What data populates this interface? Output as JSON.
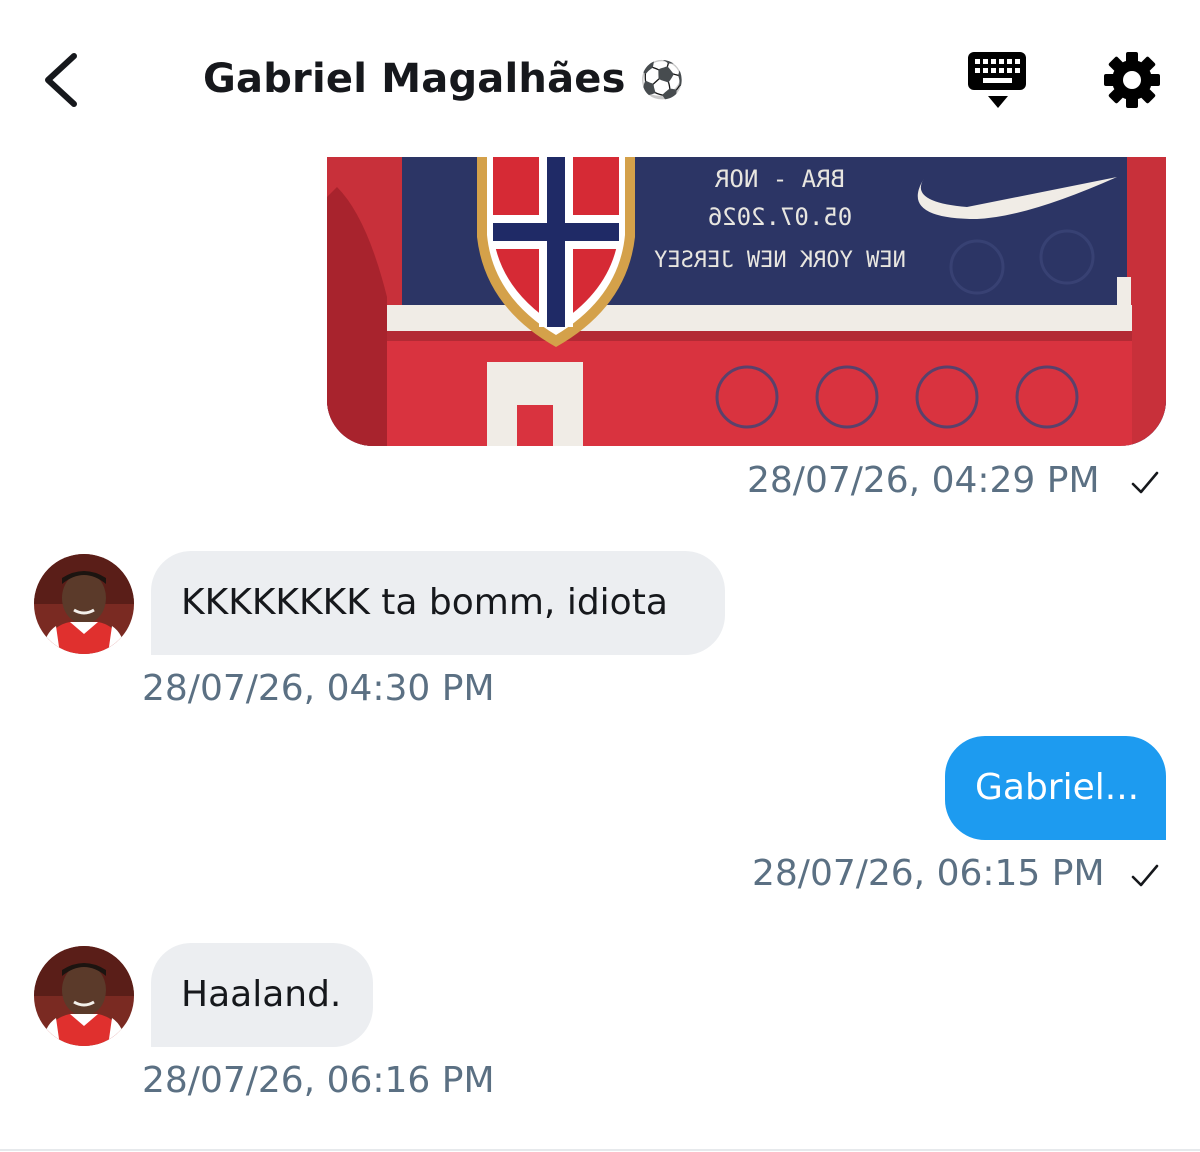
{
  "header": {
    "title": "Gabriel Magalhães",
    "title_emoji": "⚽",
    "back_icon": "chevron-left-icon",
    "keyboard_icon": "keyboard-icon",
    "settings_icon": "gear-icon"
  },
  "messages": [
    {
      "direction": "outgoing",
      "type": "image",
      "image_description_icon": "jersey-photo",
      "image_text": [
        "BRA - NOR",
        "05.07.2026",
        "NEW YORK NEW JERSEY"
      ],
      "timestamp": "28/07/26, 04:29 PM",
      "status": "✓"
    },
    {
      "direction": "incoming",
      "type": "text",
      "text": "KKKKKKKK ta bomm, idiota",
      "timestamp": "28/07/26, 04:30 PM"
    },
    {
      "direction": "outgoing",
      "type": "text",
      "text": "Gabriel...",
      "timestamp": "28/07/26, 06:15 PM",
      "status": "✓"
    },
    {
      "direction": "incoming",
      "type": "text",
      "text": "Haaland.",
      "timestamp": "28/07/26, 06:16 PM"
    }
  ],
  "colors": {
    "outgoing_bubble": "#1d9bf0",
    "incoming_bubble": "#eceef1",
    "timestamp": "#5b7083",
    "jersey_navy": "#2c3565",
    "jersey_red": "#d9333f"
  }
}
